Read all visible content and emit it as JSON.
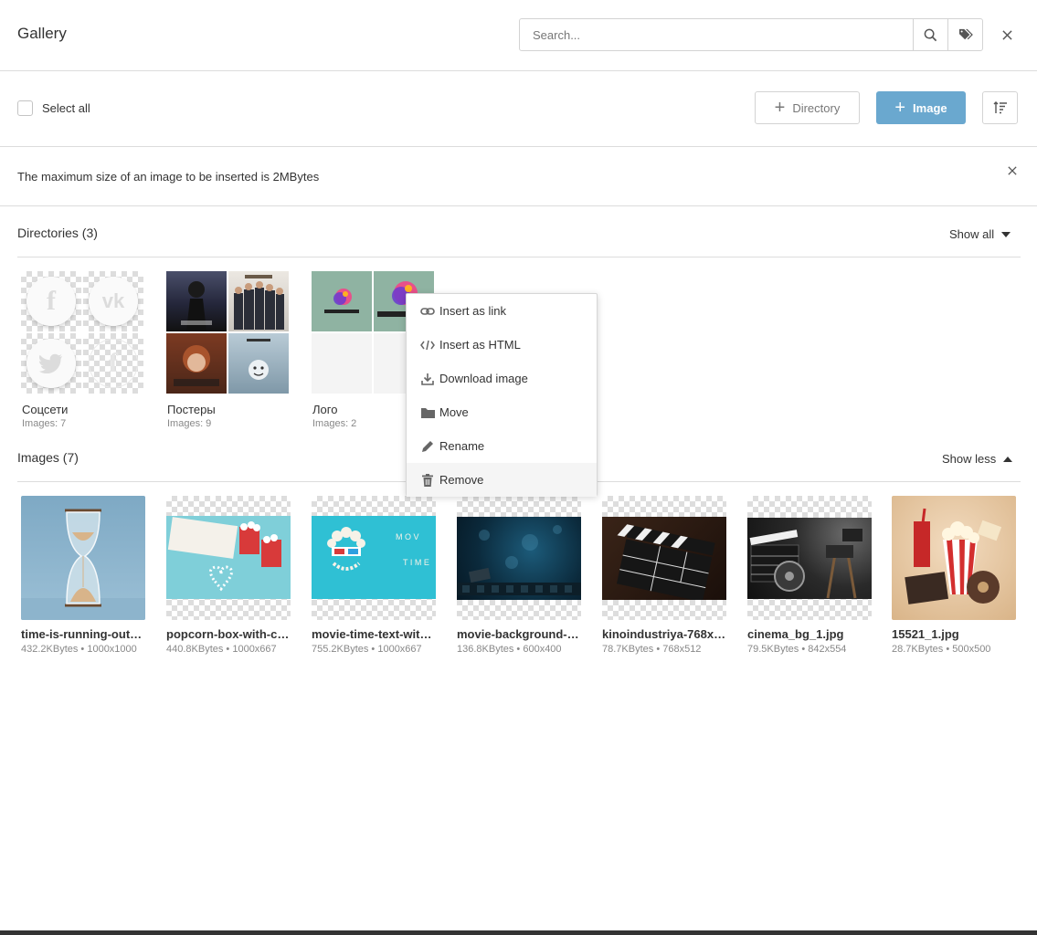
{
  "header": {
    "title": "Gallery",
    "search_placeholder": "Search..."
  },
  "toolbar": {
    "select_all_label": "Select all",
    "directory_label": "Directory",
    "image_label": "Image",
    "accent_color": "#6aa8cf"
  },
  "notice": {
    "text": "The maximum size of an image to be inserted is 2MBytes"
  },
  "directories": {
    "title": "Directories (3)",
    "toggle_label": "Show all",
    "items": [
      {
        "name": "Соцсети",
        "count": "Images: 7",
        "previews": [
          "facebook-icon",
          "vk-icon",
          "twitter-icon",
          "facebook-icon"
        ]
      },
      {
        "name": "Постеры",
        "count": "Images: 9",
        "previews": [
          "wednesday-poster",
          "the-gentlemen-poster",
          "queens-gambit-poster",
          "black-mirror-poster"
        ]
      },
      {
        "name": "Лого",
        "count": "Images: 2",
        "previews": [
          "ultracreme-logo",
          "ultracreme-logo"
        ]
      }
    ]
  },
  "images": {
    "title": "Images (7)",
    "toggle_label": "Show less",
    "items": [
      {
        "name": "time-is-running-out…",
        "meta": "432.2KBytes • 1000x1000"
      },
      {
        "name": "popcorn-box-with-c…",
        "meta": "440.8KBytes • 1000x667"
      },
      {
        "name": "movie-time-text-wit…",
        "meta": "755.2KBytes • 1000x667"
      },
      {
        "name": "movie-background-…",
        "meta": "136.8KBytes • 600x400"
      },
      {
        "name": "kinoindustriya-768x…",
        "meta": "78.7KBytes • 768x512"
      },
      {
        "name": "cinema_bg_1.jpg",
        "meta": "79.5KBytes • 842x554"
      },
      {
        "name": "15521_1.jpg",
        "meta": "28.7KBytes • 500x500"
      }
    ]
  },
  "context_menu": {
    "items": [
      {
        "label": "Insert as link",
        "icon": "link-icon"
      },
      {
        "label": "Insert as HTML",
        "icon": "code-icon"
      },
      {
        "label": "Download image",
        "icon": "download-icon"
      },
      {
        "label": "Move",
        "icon": "folder-icon"
      },
      {
        "label": "Rename",
        "icon": "pencil-icon"
      },
      {
        "label": "Remove",
        "icon": "trash-icon"
      }
    ]
  }
}
